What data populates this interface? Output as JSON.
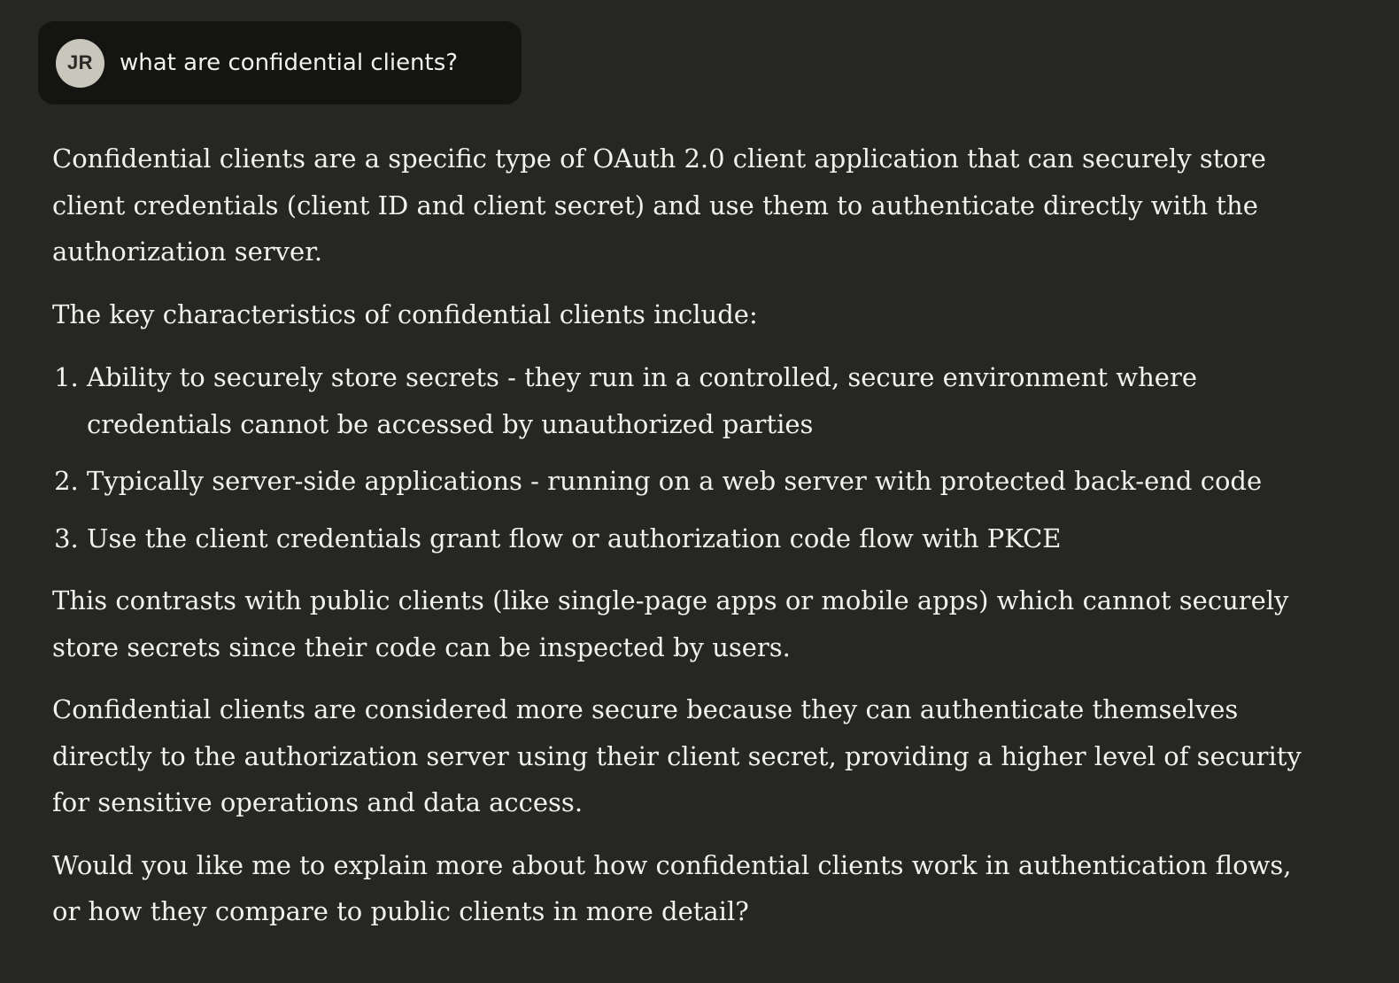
{
  "user_message": {
    "initials": "JR",
    "text": "what are confidential clients?"
  },
  "response": {
    "paragraph_1": "Confidential clients are a specific type of OAuth 2.0 client application that can securely store client credentials (client ID and client secret) and use them to authenticate directly with the authorization server.",
    "paragraph_2": "The key characteristics of confidential clients include:",
    "list_items": [
      "Ability to securely store secrets - they run in a controlled, secure environment where credentials cannot be accessed by unauthorized parties",
      "Typically server-side applications - running on a web server with protected back-end code",
      "Use the client credentials grant flow or authorization code flow with PKCE"
    ],
    "paragraph_3": "This contrasts with public clients (like single-page apps or mobile apps) which cannot securely store secrets since their code can be inspected by users.",
    "paragraph_4": "Confidential clients are considered more secure because they can authenticate themselves directly to the authorization server using their client secret, providing a higher level of security for sensitive operations and data access.",
    "paragraph_5": "Would you like me to explain more about how confidential clients work in authentication flows, or how they compare to public clients in more detail?"
  },
  "colors": {
    "background": "#262624",
    "user_bubble": "#141413",
    "avatar": "#c9c6bc",
    "text": "#f3f1ec"
  }
}
